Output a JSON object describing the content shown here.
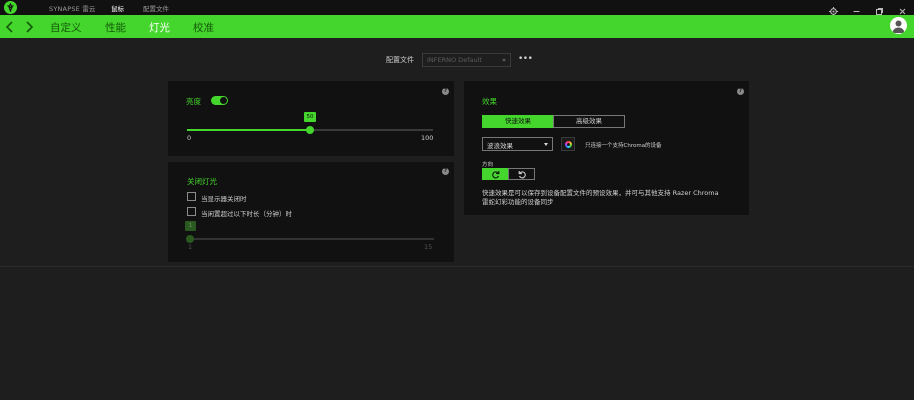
{
  "titlebar": {
    "app_title": "SYNAPSE 雷云",
    "tabs": [
      {
        "label": "鼠标",
        "active": true
      },
      {
        "label": "配置文件",
        "active": false
      }
    ]
  },
  "nav": {
    "items": [
      {
        "label": "自定义",
        "active": false
      },
      {
        "label": "性能",
        "active": false
      },
      {
        "label": "灯光",
        "active": true
      },
      {
        "label": "校准",
        "active": false
      }
    ]
  },
  "profile": {
    "label": "配置文件",
    "value": "INFERNO Default"
  },
  "brightness_panel": {
    "title": "亮度",
    "enabled": true,
    "value": "50",
    "value_fraction": 0.5,
    "min": "0",
    "max": "100"
  },
  "lights_off_panel": {
    "title": "关闭灯光",
    "option_display_off": "当显示器关闭时",
    "option_idle": "当闲置超过以下时长（分钟）时",
    "option_display_off_checked": false,
    "option_idle_checked": false,
    "idle_value": "1",
    "idle_fraction": 0,
    "min": "1",
    "max": "15"
  },
  "effect_panel": {
    "title": "效果",
    "tab_quick": "快速效果",
    "tab_advanced": "高级效果",
    "effect_value": "波浪效果",
    "chroma_note": "只连接一个支持Chroma的设备",
    "direction_label": "方向",
    "description": "快速效果是可以保存到设备配置文件的预设效果，并可与其他支持 Razer Chroma 雷蛇幻彩功能的设备同步"
  },
  "colors": {
    "accent": "#44d62c",
    "panel": "#111111",
    "background": "#1e1e1e"
  },
  "icons": {
    "logo": "razer-logo-icon",
    "settings": "gear-icon",
    "minimize": "minimize-icon",
    "maximize": "maximize-icon",
    "close": "close-icon",
    "back": "chevron-left-icon",
    "forward": "chevron-right-icon",
    "more": "more-dots-icon",
    "help": "help-icon",
    "direction_cw": "rotate-clockwise-icon",
    "direction_ccw": "rotate-counterclockwise-icon"
  }
}
